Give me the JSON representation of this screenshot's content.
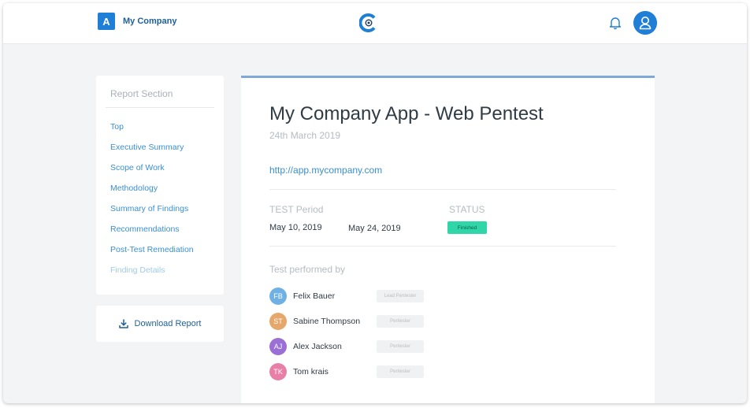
{
  "header": {
    "company_initial": "A",
    "company_name": "My Company",
    "logo_icon": "c-lens-logo-icon",
    "bell_icon": "bell-icon",
    "avatar_icon": "user-avatar-icon",
    "accent_color": "#1f7fd6"
  },
  "sidebar": {
    "title": "Report Section",
    "items": [
      {
        "label": "Top"
      },
      {
        "label": "Executive Summary"
      },
      {
        "label": "Scope of Work"
      },
      {
        "label": "Methodology"
      },
      {
        "label": "Summary of Findings"
      },
      {
        "label": "Recommendations"
      },
      {
        "label": "Post-Test Remediation"
      },
      {
        "label": "Finding Details"
      }
    ],
    "download_label": "Download Report",
    "download_icon": "download-icon"
  },
  "report": {
    "title": "My Company App - Web Pentest",
    "date": "24th March 2019",
    "url": "http://app.mycompany.com",
    "test_period_label": "TEST Period",
    "start_date": "May 10, 2019",
    "end_date": "May 24, 2019",
    "status_label": "STATUS",
    "status_value": "Finished",
    "status_color": "#31d6a8",
    "performed_by_label": "Test performed by",
    "testers": [
      {
        "initials": "FB",
        "name": "Felix Bauer",
        "role": "Lead Pentester",
        "color": "#6fb1e3"
      },
      {
        "initials": "ST",
        "name": "Sabine Thompson",
        "role": "Pentester",
        "color": "#e6a86a"
      },
      {
        "initials": "AJ",
        "name": "Alex Jackson",
        "role": "Pentester",
        "color": "#9a6fd6"
      },
      {
        "initials": "TK",
        "name": "Tom krais",
        "role": "Pentester",
        "color": "#e77fa6"
      }
    ]
  }
}
